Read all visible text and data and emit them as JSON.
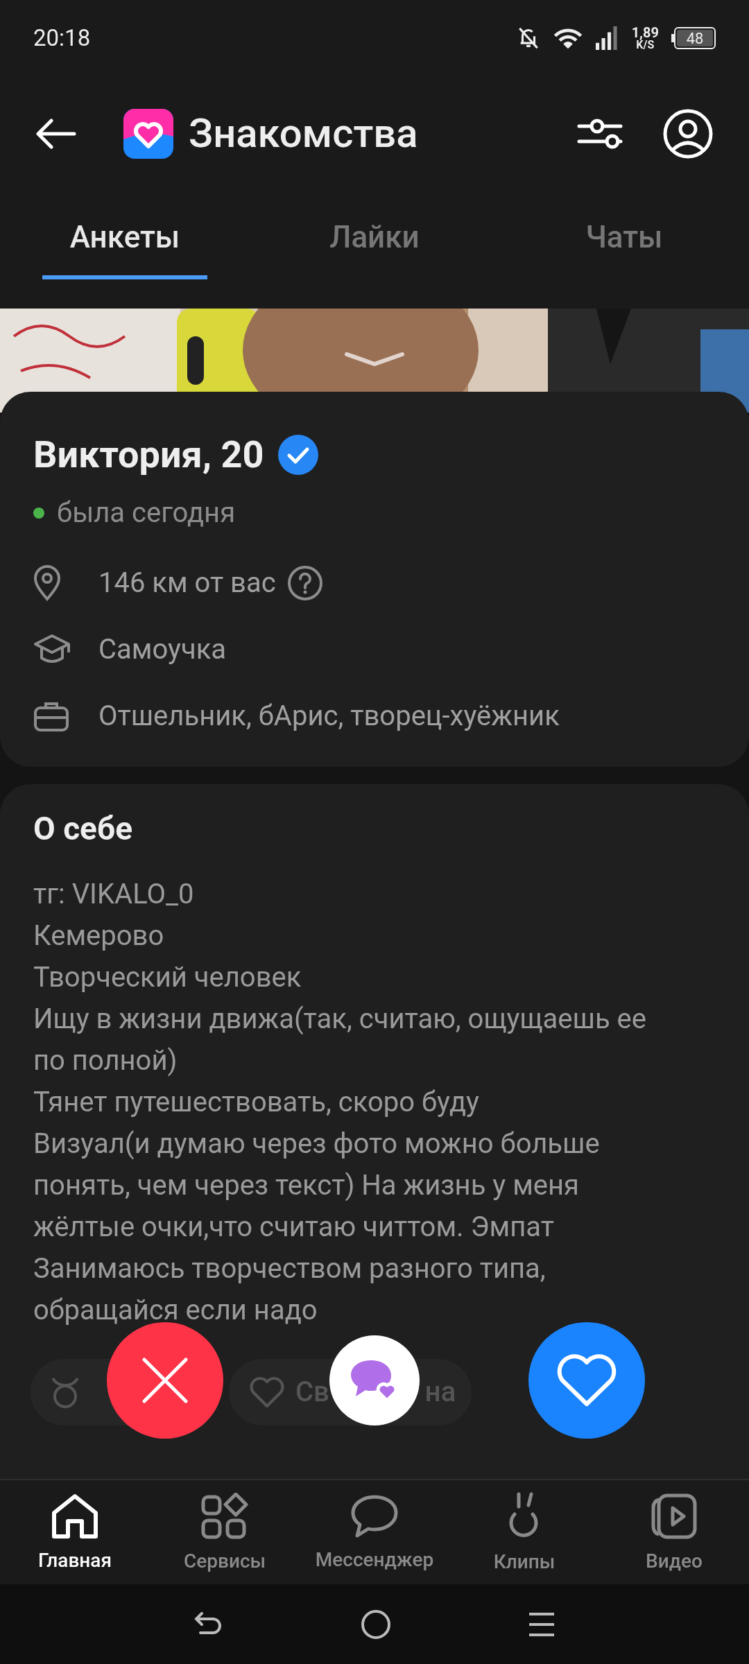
{
  "status_bar": {
    "time": "20:18",
    "speed_value": "1,89",
    "speed_unit": "K/S",
    "battery": "48"
  },
  "header": {
    "title": "Знакомства"
  },
  "tabs": [
    {
      "label": "Анкеты",
      "selected": true
    },
    {
      "label": "Лайки",
      "selected": false
    },
    {
      "label": "Чаты",
      "selected": false
    }
  ],
  "profile": {
    "name": "Виктория, 20",
    "verified": true,
    "online_status": "была сегодня",
    "details": [
      {
        "kind": "location",
        "text": "146 км от вас",
        "help": true
      },
      {
        "kind": "education",
        "text": "Самоучка",
        "help": false
      },
      {
        "kind": "work",
        "text": "Отшельник, бАрис, творец-хуёжник",
        "help": false
      }
    ]
  },
  "about": {
    "title": "О себе",
    "lines": [
      "тг: VIKALO_0",
      "Кемерово",
      "Творческий человек",
      "Ищу в жизни движа(так, считаю, ощущаешь ее по полной)",
      "Тянет путешествовать, скоро буду",
      "Визуал(и думаю через фото можно больше понять, чем через текст) На жизнь у меня жёлтые очки,что считаю читтом. Эмпат",
      "Занимаюсь творчеством разного типа, обращайся если надо"
    ],
    "tags": [
      {
        "kind": "zodiac"
      },
      {
        "kind": "heart",
        "visible_text": [
          "Св",
          "на"
        ]
      }
    ]
  },
  "actions": [
    {
      "kind": "dislike"
    },
    {
      "kind": "message"
    },
    {
      "kind": "like"
    }
  ],
  "bottom_nav": [
    {
      "kind": "home",
      "label": "Главная",
      "selected": true
    },
    {
      "kind": "services",
      "label": "Сервисы",
      "selected": false
    },
    {
      "kind": "messenger",
      "label": "Мессенджер",
      "selected": false
    },
    {
      "kind": "clips",
      "label": "Клипы",
      "selected": false
    },
    {
      "kind": "video",
      "label": "Видео",
      "selected": false
    }
  ]
}
